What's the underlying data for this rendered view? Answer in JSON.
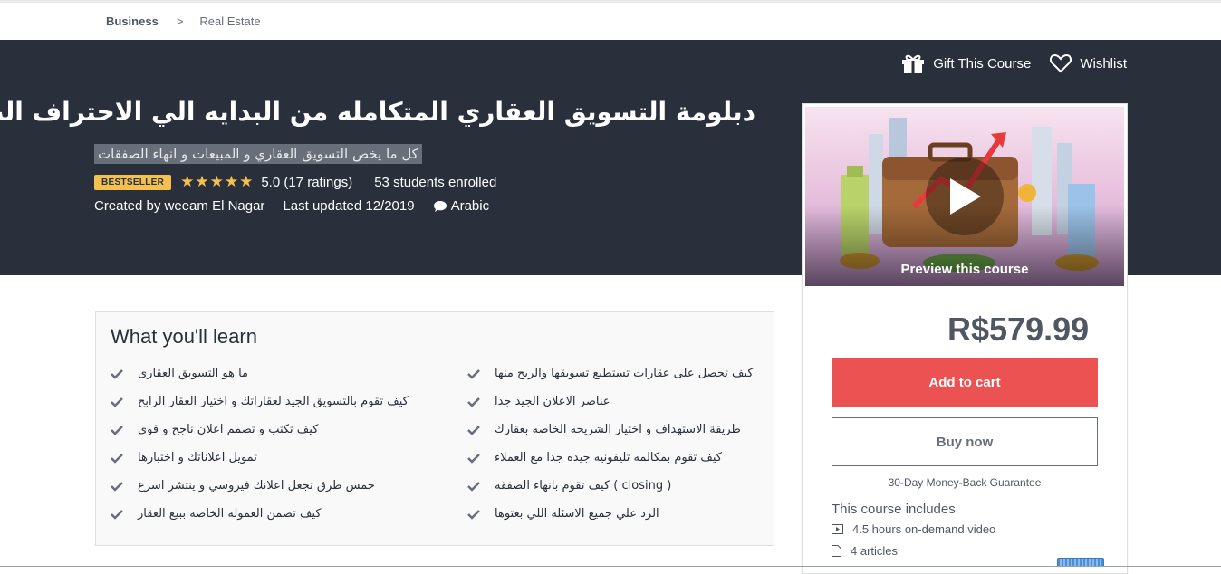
{
  "breadcrumb": {
    "items": [
      "Business",
      "Real Estate"
    ],
    "separator": ">"
  },
  "header": {
    "gift_label": "Gift This Course",
    "wishlist_label": "Wishlist",
    "title": "دبلومة التسويق العقاري المتكامله من البدايه الي الاحتراف الت",
    "subtitle": "كل ما يخص التسويق العقاري و المبيعات و انهاء الصفقات",
    "badge": "BESTSELLER",
    "stars": "★★★★★",
    "rating_text": "5.0 (17 ratings)",
    "enrolled_text": "53 students enrolled",
    "created_by": "Created by weeam El Nagar",
    "last_updated": "Last updated 12/2019",
    "language": "Arabic"
  },
  "learn": {
    "title": "What you'll learn",
    "left_items": [
      "ما هو التسويق العقارى",
      "كيف تقوم بالتسويق الجيد لعقاراتك و اختيار العقار الرابح",
      "كيف تكتب و تصمم اعلان ناجح و قوي",
      "تمويل اعلاناتك و اختبارها",
      "خمس طرق تجعل اعلانك فيروسي و ينتشر اسرع",
      "كيف تضمن العموله الخاصه ببيع العقار"
    ],
    "right_items": [
      "كيف تحصل على عقارات تستطيع تسويقها والربح منها",
      "عناصر الاعلان الجيد جدا",
      "طريقة الاستهداف و اختيار الشريحه الخاصه بعقارك",
      "كيف تقوم بمكالمه تليفونيه جيده جدا مع العملاء",
      "( closing ) كيف تقوم بانهاء الصفقه",
      "الرد علي جميع الاسئله اللي بعتوها"
    ]
  },
  "sidebar": {
    "preview_label": "Preview this course",
    "price": "R$579.99",
    "add_to_cart": "Add to cart",
    "buy_now": "Buy now",
    "guarantee": "30-Day Money-Back Guarantee",
    "includes_title": "This course includes",
    "includes": [
      {
        "icon": "video-icon",
        "text": "4.5 hours on-demand video"
      },
      {
        "icon": "article-icon",
        "text": "4 articles"
      }
    ]
  },
  "colors": {
    "hero_bg": "#29303b",
    "cart_red": "#ec5252",
    "star_gold": "#f4c150"
  }
}
